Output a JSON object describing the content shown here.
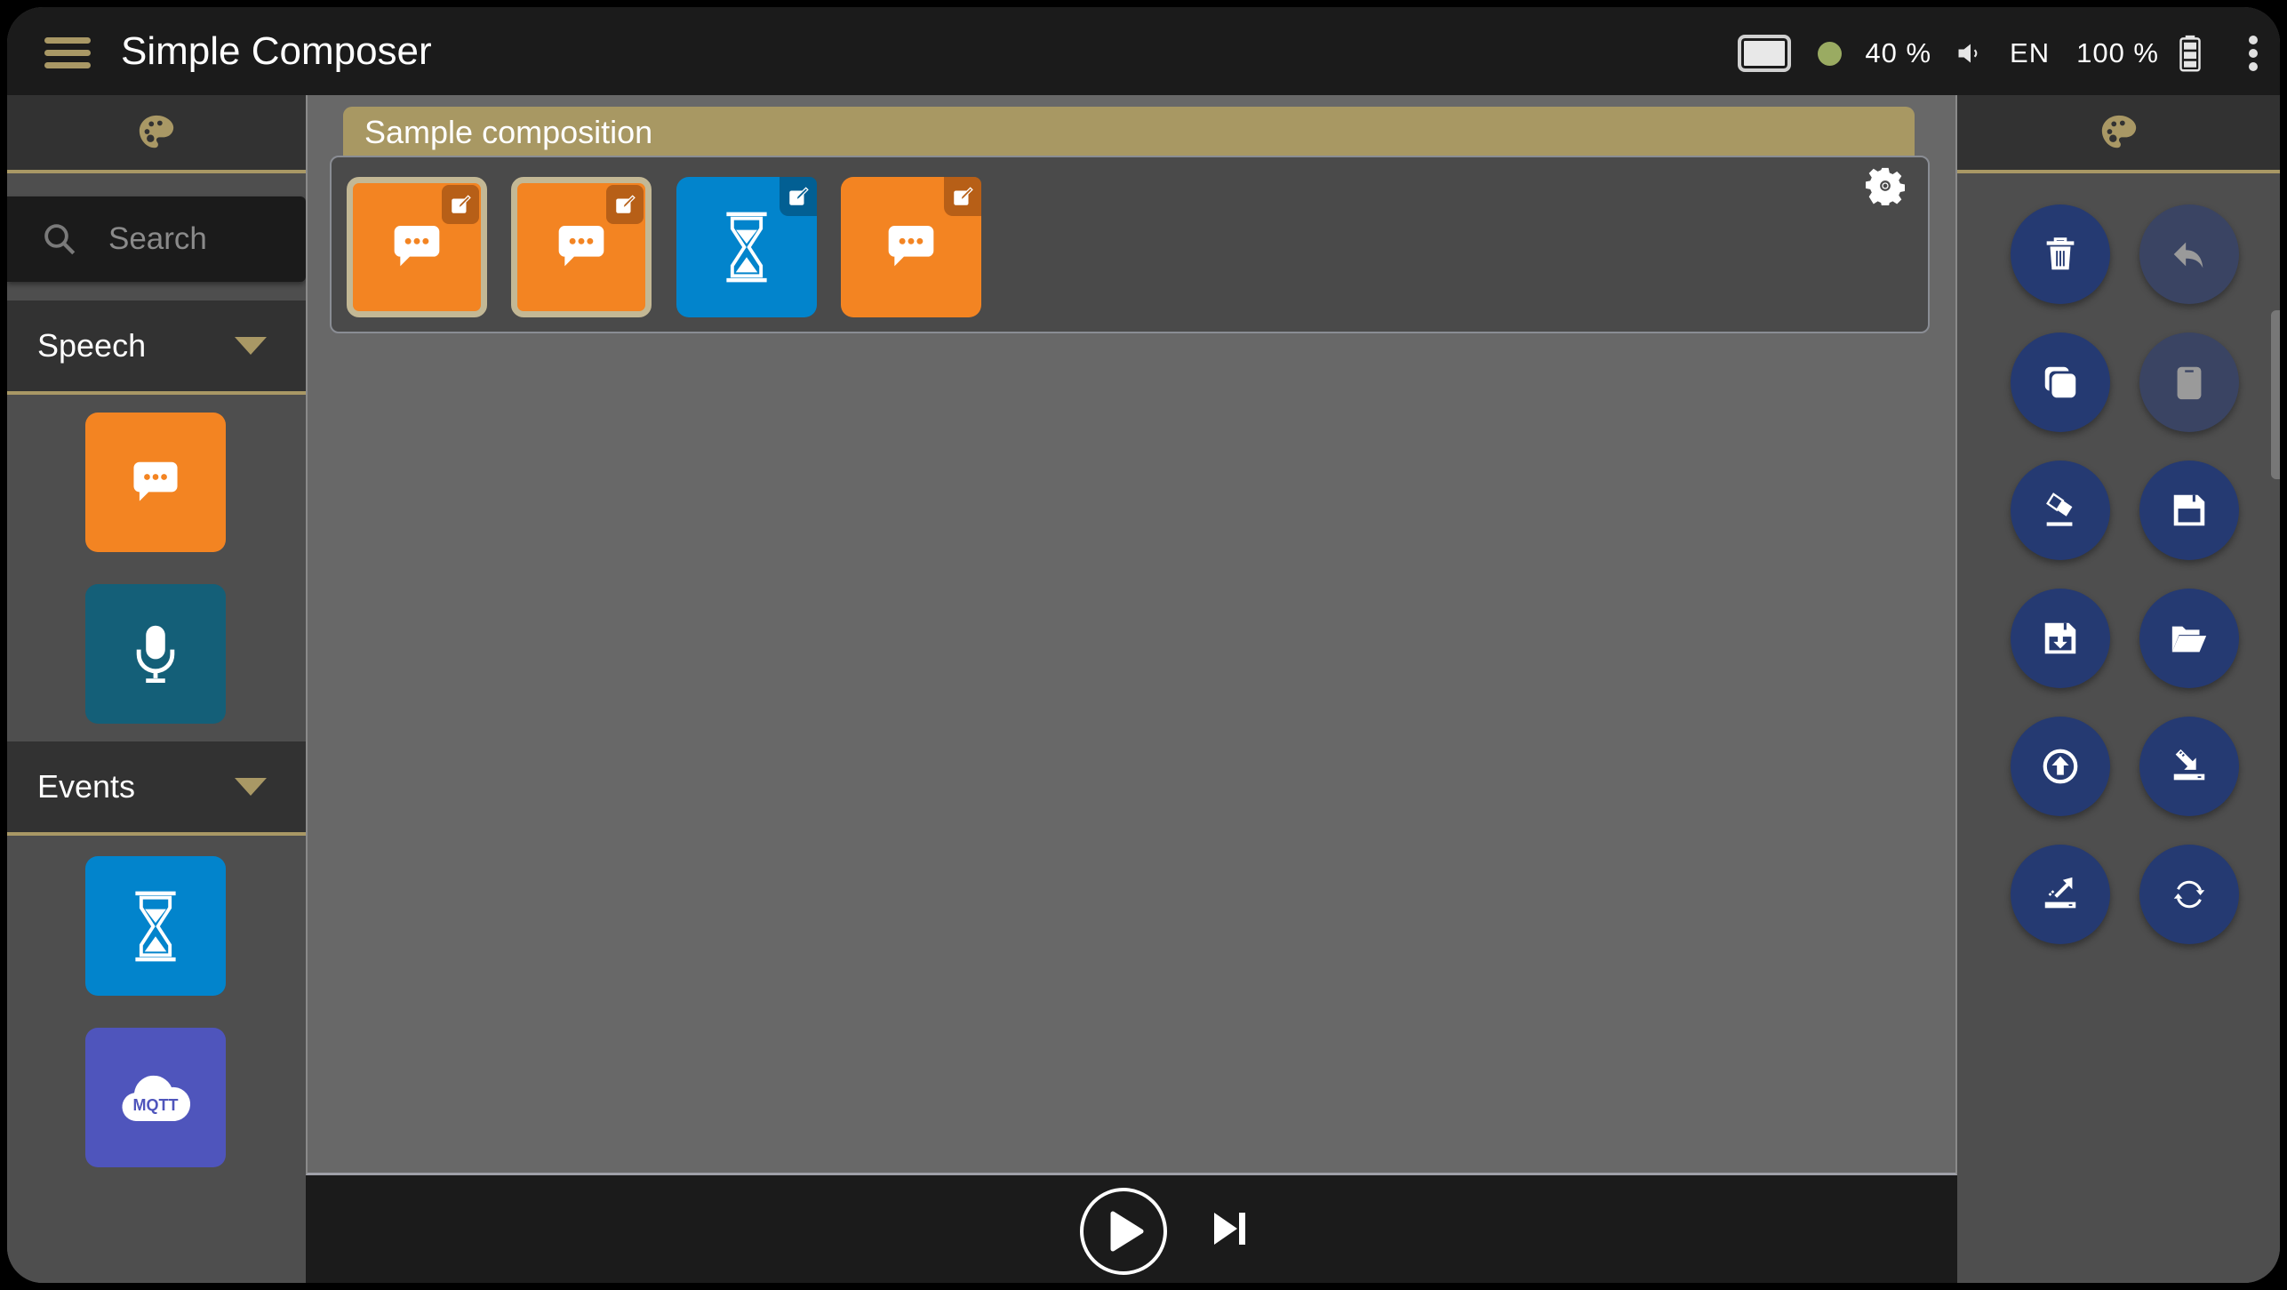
{
  "app": {
    "title": "Simple Composer",
    "menu_icon": "hamburger-menu-icon"
  },
  "status_bar": {
    "screen_icon": "screen-icon",
    "connection_color": "#9aab62",
    "volume_level": "40 %",
    "volume_icon": "speaker-icon",
    "language": "EN",
    "battery_level": "100 %",
    "battery_icon": "battery-icon",
    "more_icon": "more-vert-icon"
  },
  "left_panel": {
    "header_icon": "palette-icon",
    "search": {
      "placeholder": "Search",
      "value": ""
    },
    "categories": [
      {
        "label": "Speech",
        "expanded": true,
        "items": [
          {
            "name": "say",
            "icon": "speech-bubble-icon",
            "color": "#f38422"
          },
          {
            "name": "listen",
            "icon": "microphone-icon",
            "color": "#145f78"
          }
        ]
      },
      {
        "label": "Events",
        "expanded": true,
        "items": [
          {
            "name": "wait",
            "icon": "hourglass-icon",
            "color": "#0284cc"
          },
          {
            "name": "mqtt",
            "icon": "mqtt-cloud-icon",
            "label": "MQTT",
            "color": "#4f55bc"
          }
        ]
      }
    ]
  },
  "composition": {
    "title": "Sample composition",
    "settings_icon": "gear-icon",
    "blocks": [
      {
        "icon": "speech-bubble-icon",
        "color": "#f38422",
        "selected": true
      },
      {
        "icon": "speech-bubble-icon",
        "color": "#f38422",
        "selected": true
      },
      {
        "icon": "hourglass-icon",
        "color": "#0284cc",
        "selected": false
      },
      {
        "icon": "speech-bubble-icon",
        "color": "#f38422",
        "selected": false
      }
    ]
  },
  "player": {
    "play_icon": "play-circle-icon",
    "step_icon": "skip-next-icon"
  },
  "right_panel": {
    "header_icon": "palette-icon",
    "actions": [
      {
        "name": "delete",
        "icon": "trash-icon",
        "enabled": true
      },
      {
        "name": "undo",
        "icon": "undo-icon",
        "enabled": false
      },
      {
        "name": "copy",
        "icon": "copy-icon",
        "enabled": true
      },
      {
        "name": "paste",
        "icon": "clipboard-icon",
        "enabled": false
      },
      {
        "name": "clear",
        "icon": "eraser-icon",
        "enabled": true
      },
      {
        "name": "save",
        "icon": "floppy-icon",
        "enabled": true
      },
      {
        "name": "save-as",
        "icon": "floppy-download-icon",
        "enabled": true
      },
      {
        "name": "open",
        "icon": "folder-open-icon",
        "enabled": true
      },
      {
        "name": "upload",
        "icon": "upload-circle-icon",
        "enabled": true
      },
      {
        "name": "import",
        "icon": "import-icon",
        "enabled": true
      },
      {
        "name": "export",
        "icon": "export-icon",
        "enabled": true
      },
      {
        "name": "sync",
        "icon": "sync-icon",
        "enabled": true
      }
    ]
  }
}
